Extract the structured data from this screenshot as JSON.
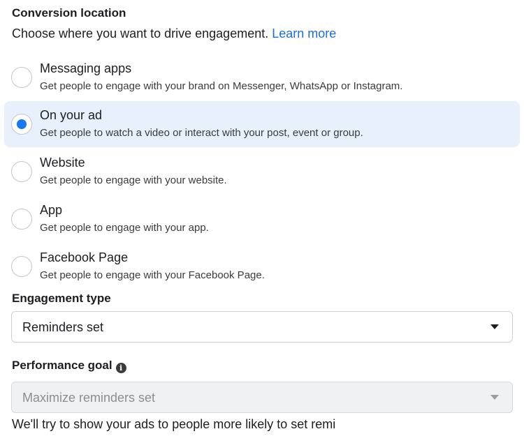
{
  "conversion_location": {
    "title": "Conversion location",
    "subtitle": "Choose where you want to drive engagement.",
    "learn_more": "Learn more",
    "options": [
      {
        "label": "Messaging apps",
        "description": "Get people to engage with your brand on Messenger, WhatsApp or Instagram.",
        "selected": false
      },
      {
        "label": "On your ad",
        "description": "Get people to watch a video or interact with your post, event or group.",
        "selected": true
      },
      {
        "label": "Website",
        "description": "Get people to engage with your website.",
        "selected": false
      },
      {
        "label": "App",
        "description": "Get people to engage with your app.",
        "selected": false
      },
      {
        "label": "Facebook Page",
        "description": "Get people to engage with your Facebook Page.",
        "selected": false
      }
    ]
  },
  "engagement_type": {
    "title": "Engagement type",
    "value": "Reminders set"
  },
  "performance_goal": {
    "title": "Performance goal",
    "info_icon": "info-icon",
    "info_glyph": "i",
    "value": "Maximize reminders set",
    "disabled": true,
    "note": "We'll try to show your ads to people more likely to set remi"
  },
  "colors": {
    "accent": "#1877f2",
    "link": "#1a6ed8",
    "selected_background": "#e8f0fc"
  }
}
